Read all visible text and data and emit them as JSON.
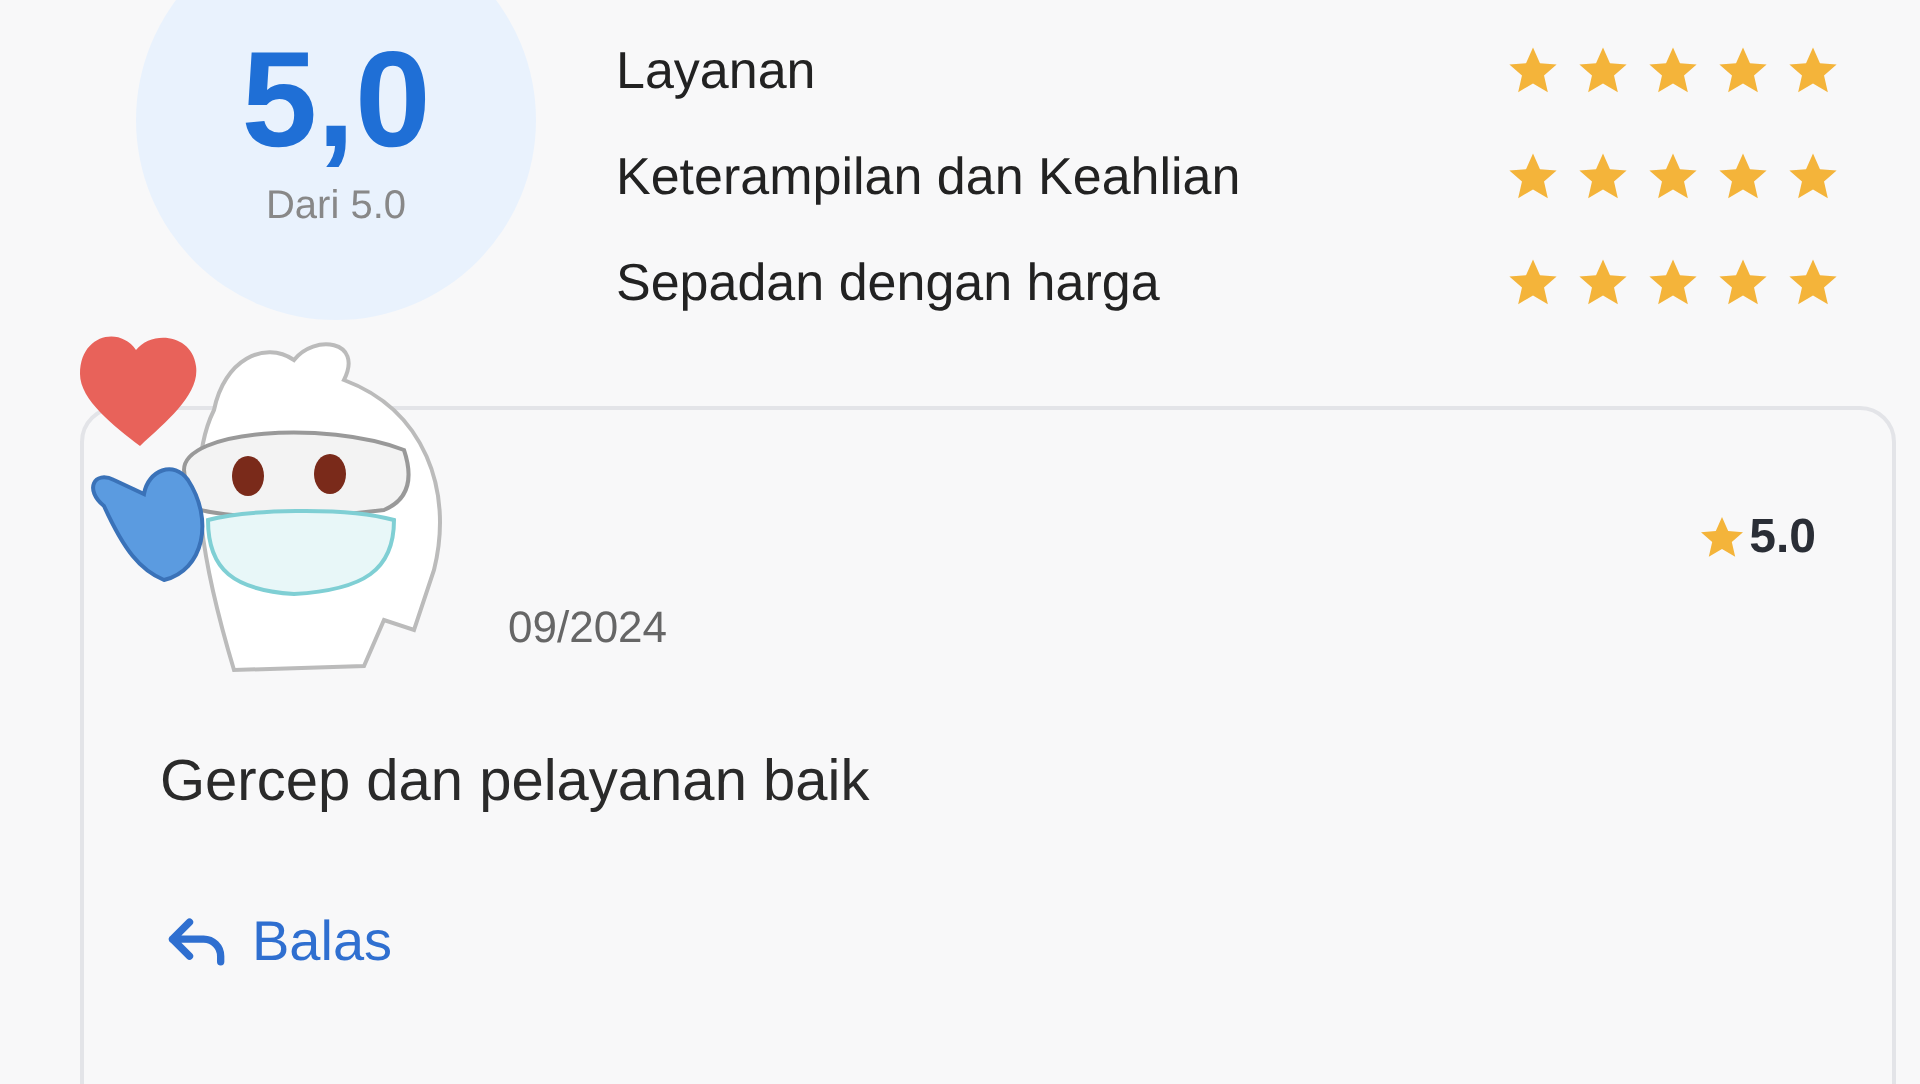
{
  "summary": {
    "score": "5,0",
    "subtitle": "Dari 5.0"
  },
  "criteria": [
    {
      "label": "Layanan",
      "stars": 5
    },
    {
      "label": "Keterampilan dan Keahlian",
      "stars": 5
    },
    {
      "label": "Sepadan dengan harga",
      "stars": 5
    }
  ],
  "review": {
    "rating": "5.0",
    "date": "09/2024",
    "text": "Gercep dan pelayanan baik",
    "reply_button": "Balas"
  }
}
